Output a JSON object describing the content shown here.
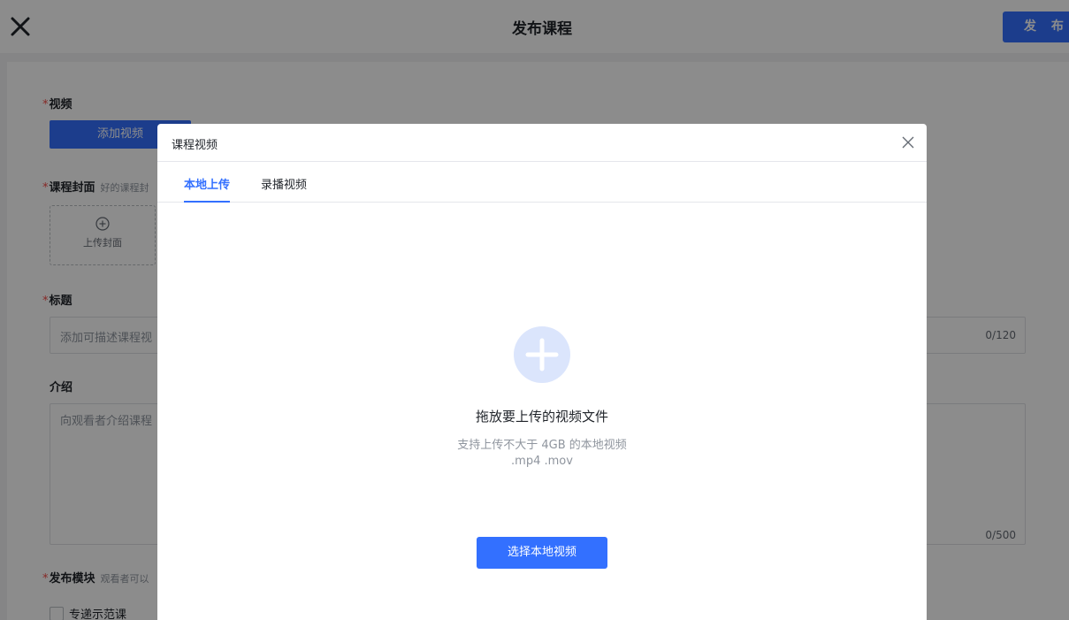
{
  "header": {
    "title": "发布课程",
    "publish_label": "发 布"
  },
  "form": {
    "video": {
      "label": "视频",
      "button": "添加视频"
    },
    "cover": {
      "label": "课程封面",
      "hint": "好的课程封",
      "upload_label": "上传封面"
    },
    "title": {
      "label": "标题",
      "placeholder": "添加可描述课程视",
      "count": "0/120"
    },
    "intro": {
      "label": "介绍",
      "placeholder": "向观看者介绍课程",
      "count": "0/500"
    },
    "module": {
      "label": "发布模块",
      "hint": "观看者可以",
      "option": "专递示范课"
    }
  },
  "modal": {
    "title": "课程视频",
    "tabs": [
      {
        "label": "本地上传",
        "active": true
      },
      {
        "label": "录播视频",
        "active": false
      }
    ],
    "upload": {
      "title": "拖放要上传的视频文件",
      "hint": "支持上传不大于 4GB 的本地视频",
      "formats": ".mp4 .mov",
      "button": "选择本地视频"
    }
  },
  "colors": {
    "primary": "#3370ff",
    "required": "#f54a45",
    "upload_circle": "#dbe5fc"
  },
  "icons": {
    "close_page": "close-icon",
    "close_modal": "close-icon",
    "cover_add": "plus-circle-icon",
    "upload_add": "plus-icon"
  }
}
